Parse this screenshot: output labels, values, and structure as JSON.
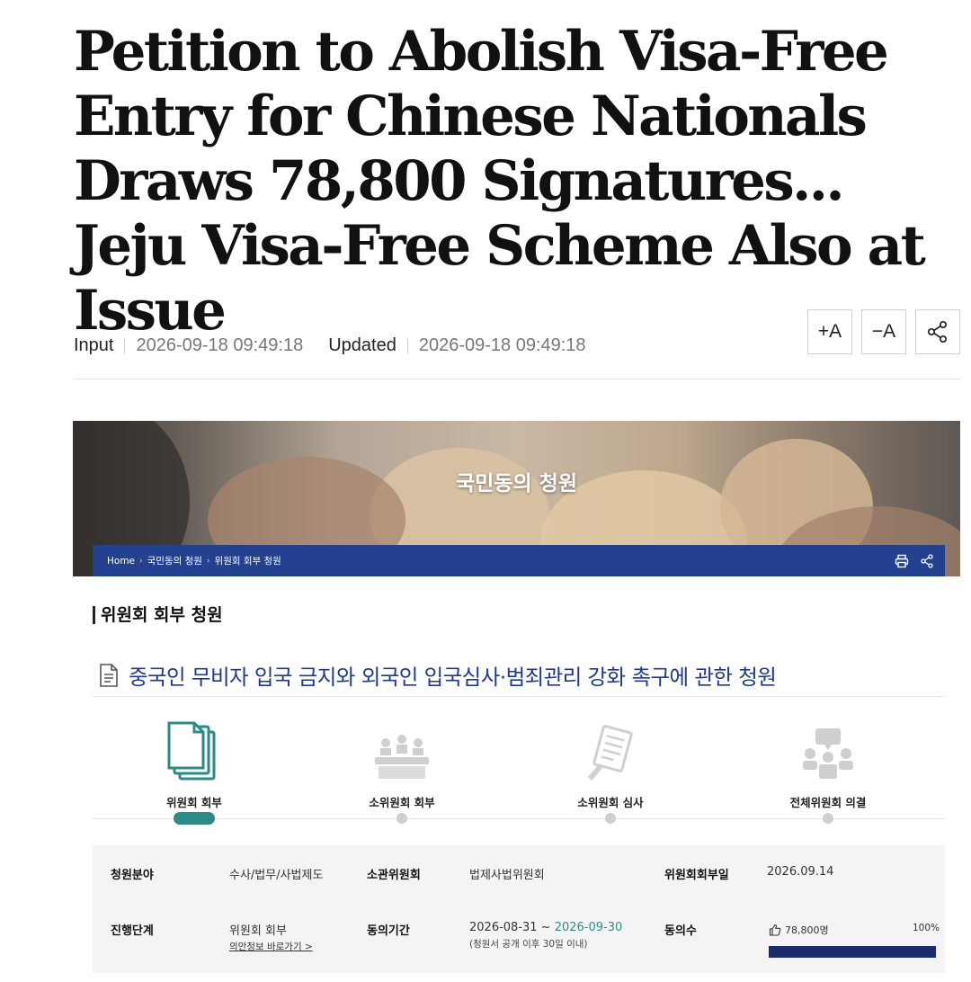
{
  "article": {
    "headline": "Petition to Abolish Visa-Free Entry for Chinese Nationals Draws 78,800 Signatures... Jeju Visa-Free Scheme Also at Issue",
    "input_label": "Input",
    "input_time": "2026-09-18 09:49:18",
    "updated_label": "Updated",
    "updated_time": "2026-09-18 09:49:18",
    "tools": {
      "font_up": "+A",
      "font_down": "−A"
    }
  },
  "screenshot": {
    "banner_title": "국민동의 청원",
    "breadcrumb": [
      "Home",
      "국민동의 청원",
      "위원회 회부 청원"
    ],
    "section_title": "위원회 회부 청원",
    "petition_title": "중국인 무비자 입국 금지와 외국인 입국심사·범죄관리 강화 촉구에 관한 청원",
    "steps": [
      {
        "label": "위원회 회부",
        "icon": "document-stack-icon",
        "active": true
      },
      {
        "label": "소위원회 회부",
        "icon": "meeting-table-icon",
        "active": false
      },
      {
        "label": "소위원회 심사",
        "icon": "review-document-icon",
        "active": false
      },
      {
        "label": "전체위원회 의결",
        "icon": "committee-vote-icon",
        "active": false
      }
    ],
    "info": {
      "field_label": "청원분야",
      "field_value": "수사/법무/사법제도",
      "committee_label": "소관위원회",
      "committee_value": "법제사법위원회",
      "referral_date_label": "위원회회부일",
      "referral_date_value": "2026.09.14",
      "stage_label": "진행단계",
      "stage_value": "위원회 회부",
      "stage_link": "의안정보 바로가기 >",
      "period_label": "동의기간",
      "period_start": "2026-08-31 ~ ",
      "period_end": "2026-09-30",
      "period_note": "(청원서 공개 이후 30일 이내)",
      "consent_label": "동의수",
      "consent_count": "78,800명",
      "consent_percent": "100%",
      "consent_progress": 1.0
    },
    "colors": {
      "nav_blue": "#23418e",
      "accent_teal": "#2d8a87",
      "progress_navy": "#1c2a6e",
      "title_blue": "#1f3a8a"
    }
  }
}
